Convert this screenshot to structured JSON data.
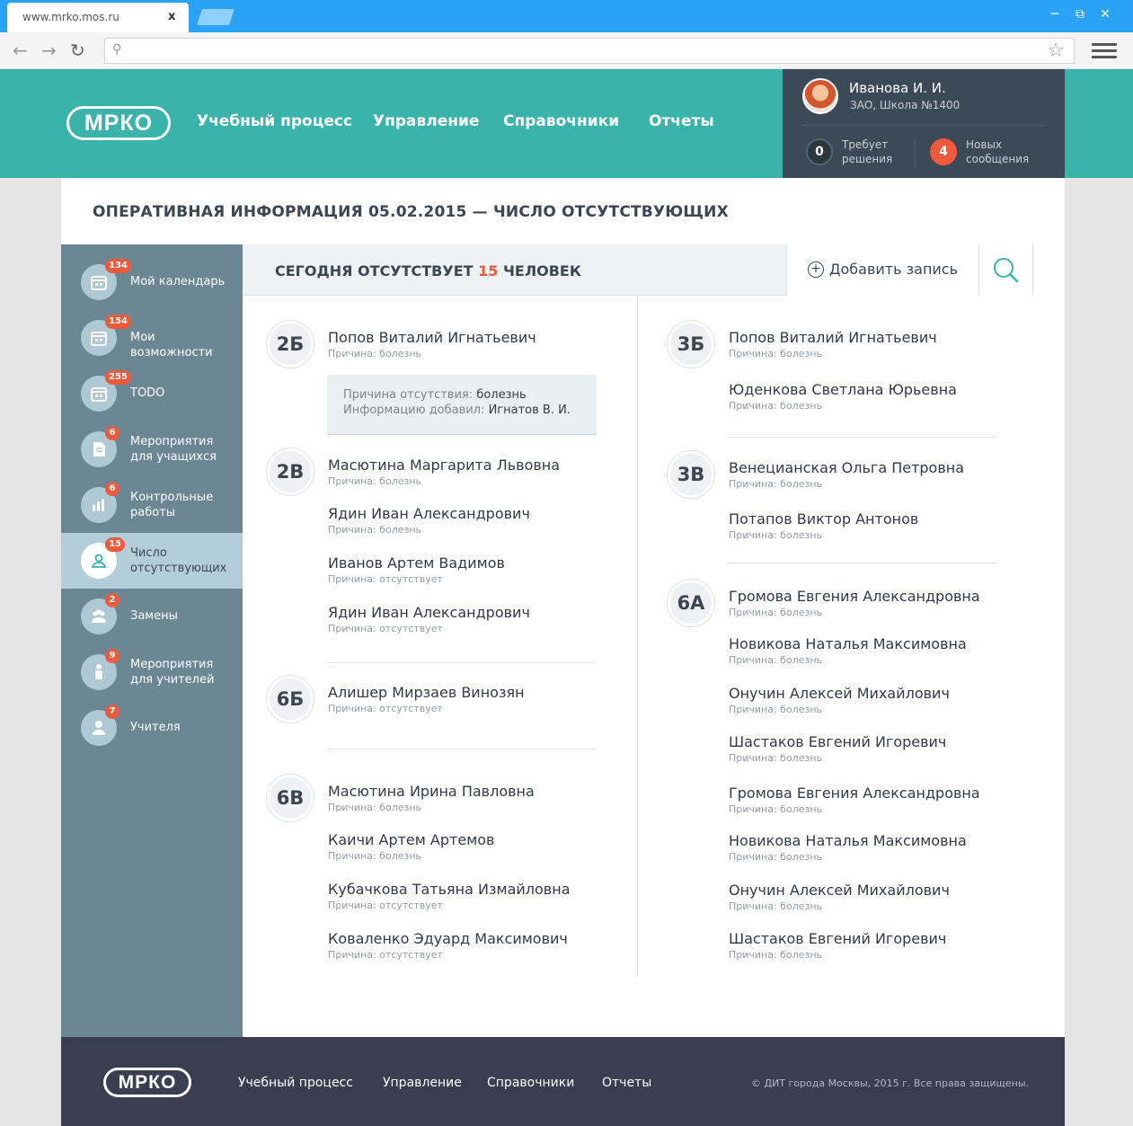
{
  "browser": {
    "tab_title": "www.mrko.mos.ru",
    "tab_close": "x"
  },
  "header": {
    "logo": "МРКО",
    "nav": [
      "Учебный процесс",
      "Управление",
      "Справочники",
      "Отчеты"
    ],
    "user": {
      "name": "Иванова И. И.",
      "school": "ЗАО, Школа №1400",
      "pending_count": "0",
      "pending_label": "Требует решения",
      "messages_count": "4",
      "messages_label": "Новых сообщения"
    }
  },
  "page": {
    "title": "ОПЕРАТИВНАЯ ИНФОРМАЦИЯ 05.02.2015 — ЧИСЛО ОТСУТСТВУЮЩИХ"
  },
  "sidebar": {
    "items": [
      {
        "label": "Мой календарь",
        "badge": "134",
        "icon": "calendar-icon"
      },
      {
        "label": "Мои возможности",
        "badge": "154",
        "icon": "calendar-icon"
      },
      {
        "label": "TODO",
        "badge": "255",
        "icon": "calendar-icon"
      },
      {
        "label": "Мероприятия для учащихся",
        "badge": "6",
        "icon": "document-icon"
      },
      {
        "label": "Контрольные работы",
        "badge": "6",
        "icon": "chart-icon"
      },
      {
        "label": "Число отсутствующих",
        "badge": "15",
        "icon": "users-icon",
        "active": true
      },
      {
        "label": "Замены",
        "badge": "2",
        "icon": "group-icon"
      },
      {
        "label": "Мероприятия для учителей",
        "badge": "9",
        "icon": "person-icon"
      },
      {
        "label": "Учителя",
        "badge": "7",
        "icon": "teacher-icon"
      }
    ]
  },
  "content": {
    "absent_prefix": "СЕГОДНЯ ОТСУТСТВУЕТ",
    "absent_count": "15",
    "absent_suffix": "ЧЕЛОВЕК",
    "add_label": "Добавить запись",
    "info": {
      "reason_label": "Причина отсутствия:",
      "reason_value": "болезнь",
      "added_label": "Информацию добавил:",
      "added_value": "Игнатов В. И."
    },
    "left_classes": [
      {
        "name": "2Б",
        "people": [
          {
            "name": "Попов Виталий Игнатьевич",
            "reason": "Причина: болезнь"
          }
        ]
      },
      {
        "name": "2В",
        "people": [
          {
            "name": "Масютина Маргарита Львовна",
            "reason": "Причина: болезнь"
          },
          {
            "name": "Ядин Иван Александрович",
            "reason": "Причина: болезнь"
          },
          {
            "name": "Иванов Артем Вадимов",
            "reason": "Причина: отсутствует"
          },
          {
            "name": "Ядин Иван Александрович",
            "reason": "Причина: отсутствует"
          }
        ]
      },
      {
        "name": "6Б",
        "people": [
          {
            "name": "Алишер Мирзаев Винозян",
            "reason": "Причина: отсутствует"
          }
        ]
      },
      {
        "name": "6В",
        "people": [
          {
            "name": "Масютина Ирина Павловна",
            "reason": "Причина: болезнь"
          },
          {
            "name": "Каичи Артем Артемов",
            "reason": "Причина: болезнь"
          },
          {
            "name": "Кубачкова Татьяна Измайловна",
            "reason": "Причина: отсутствует"
          },
          {
            "name": "Коваленко Эдуард Максимович",
            "reason": "Причина: отсутствует"
          }
        ]
      }
    ],
    "right_classes": [
      {
        "name": "3Б",
        "people": [
          {
            "name": "Попов Виталий Игнатьевич",
            "reason": "Причина: болезнь"
          },
          {
            "name": "Юденкова Светлана Юрьевна",
            "reason": "Причина: болезнь"
          }
        ]
      },
      {
        "name": "3В",
        "people": [
          {
            "name": "Венецианская Ольга Петровна",
            "reason": "Причина: болезнь"
          },
          {
            "name": "Потапов Виктор Антонов",
            "reason": "Причина: болезнь"
          }
        ]
      },
      {
        "name": "6А",
        "people": [
          {
            "name": "Громова Евгения Александровна",
            "reason": "Причина: болезнь"
          },
          {
            "name": "Новикова Наталья Максимовна",
            "reason": "Причина: болезнь"
          },
          {
            "name": "Онучин Алексей Михайлович",
            "reason": "Причина: болезнь"
          },
          {
            "name": "Шастаков Евгений Игоревич",
            "reason": "Причина: болезнь"
          },
          {
            "name": "Громова Евгения Александровна",
            "reason": "Причина: болезнь"
          },
          {
            "name": "Новикова Наталья Максимовна",
            "reason": "Причина: болезнь"
          },
          {
            "name": "Онучин Алексей Михайлович",
            "reason": "Причина: болезнь"
          },
          {
            "name": "Шастаков Евгений Игоревич",
            "reason": "Причина: болезнь"
          }
        ]
      }
    ]
  },
  "footer": {
    "logo": "МРКО",
    "nav": [
      "Учебный процесс",
      "Управление",
      "Справочники",
      "Отчеты"
    ],
    "copyright": "© ДИТ города Москвы, 2015 г. Все права защищены."
  },
  "colors": {
    "header": "#3ab3ab",
    "user_panel": "#3b4a56",
    "sidebar": "#6c8794",
    "sidebar_active": "#b4ced9",
    "accent": "#f05a3c",
    "footer": "#3b3d50"
  }
}
